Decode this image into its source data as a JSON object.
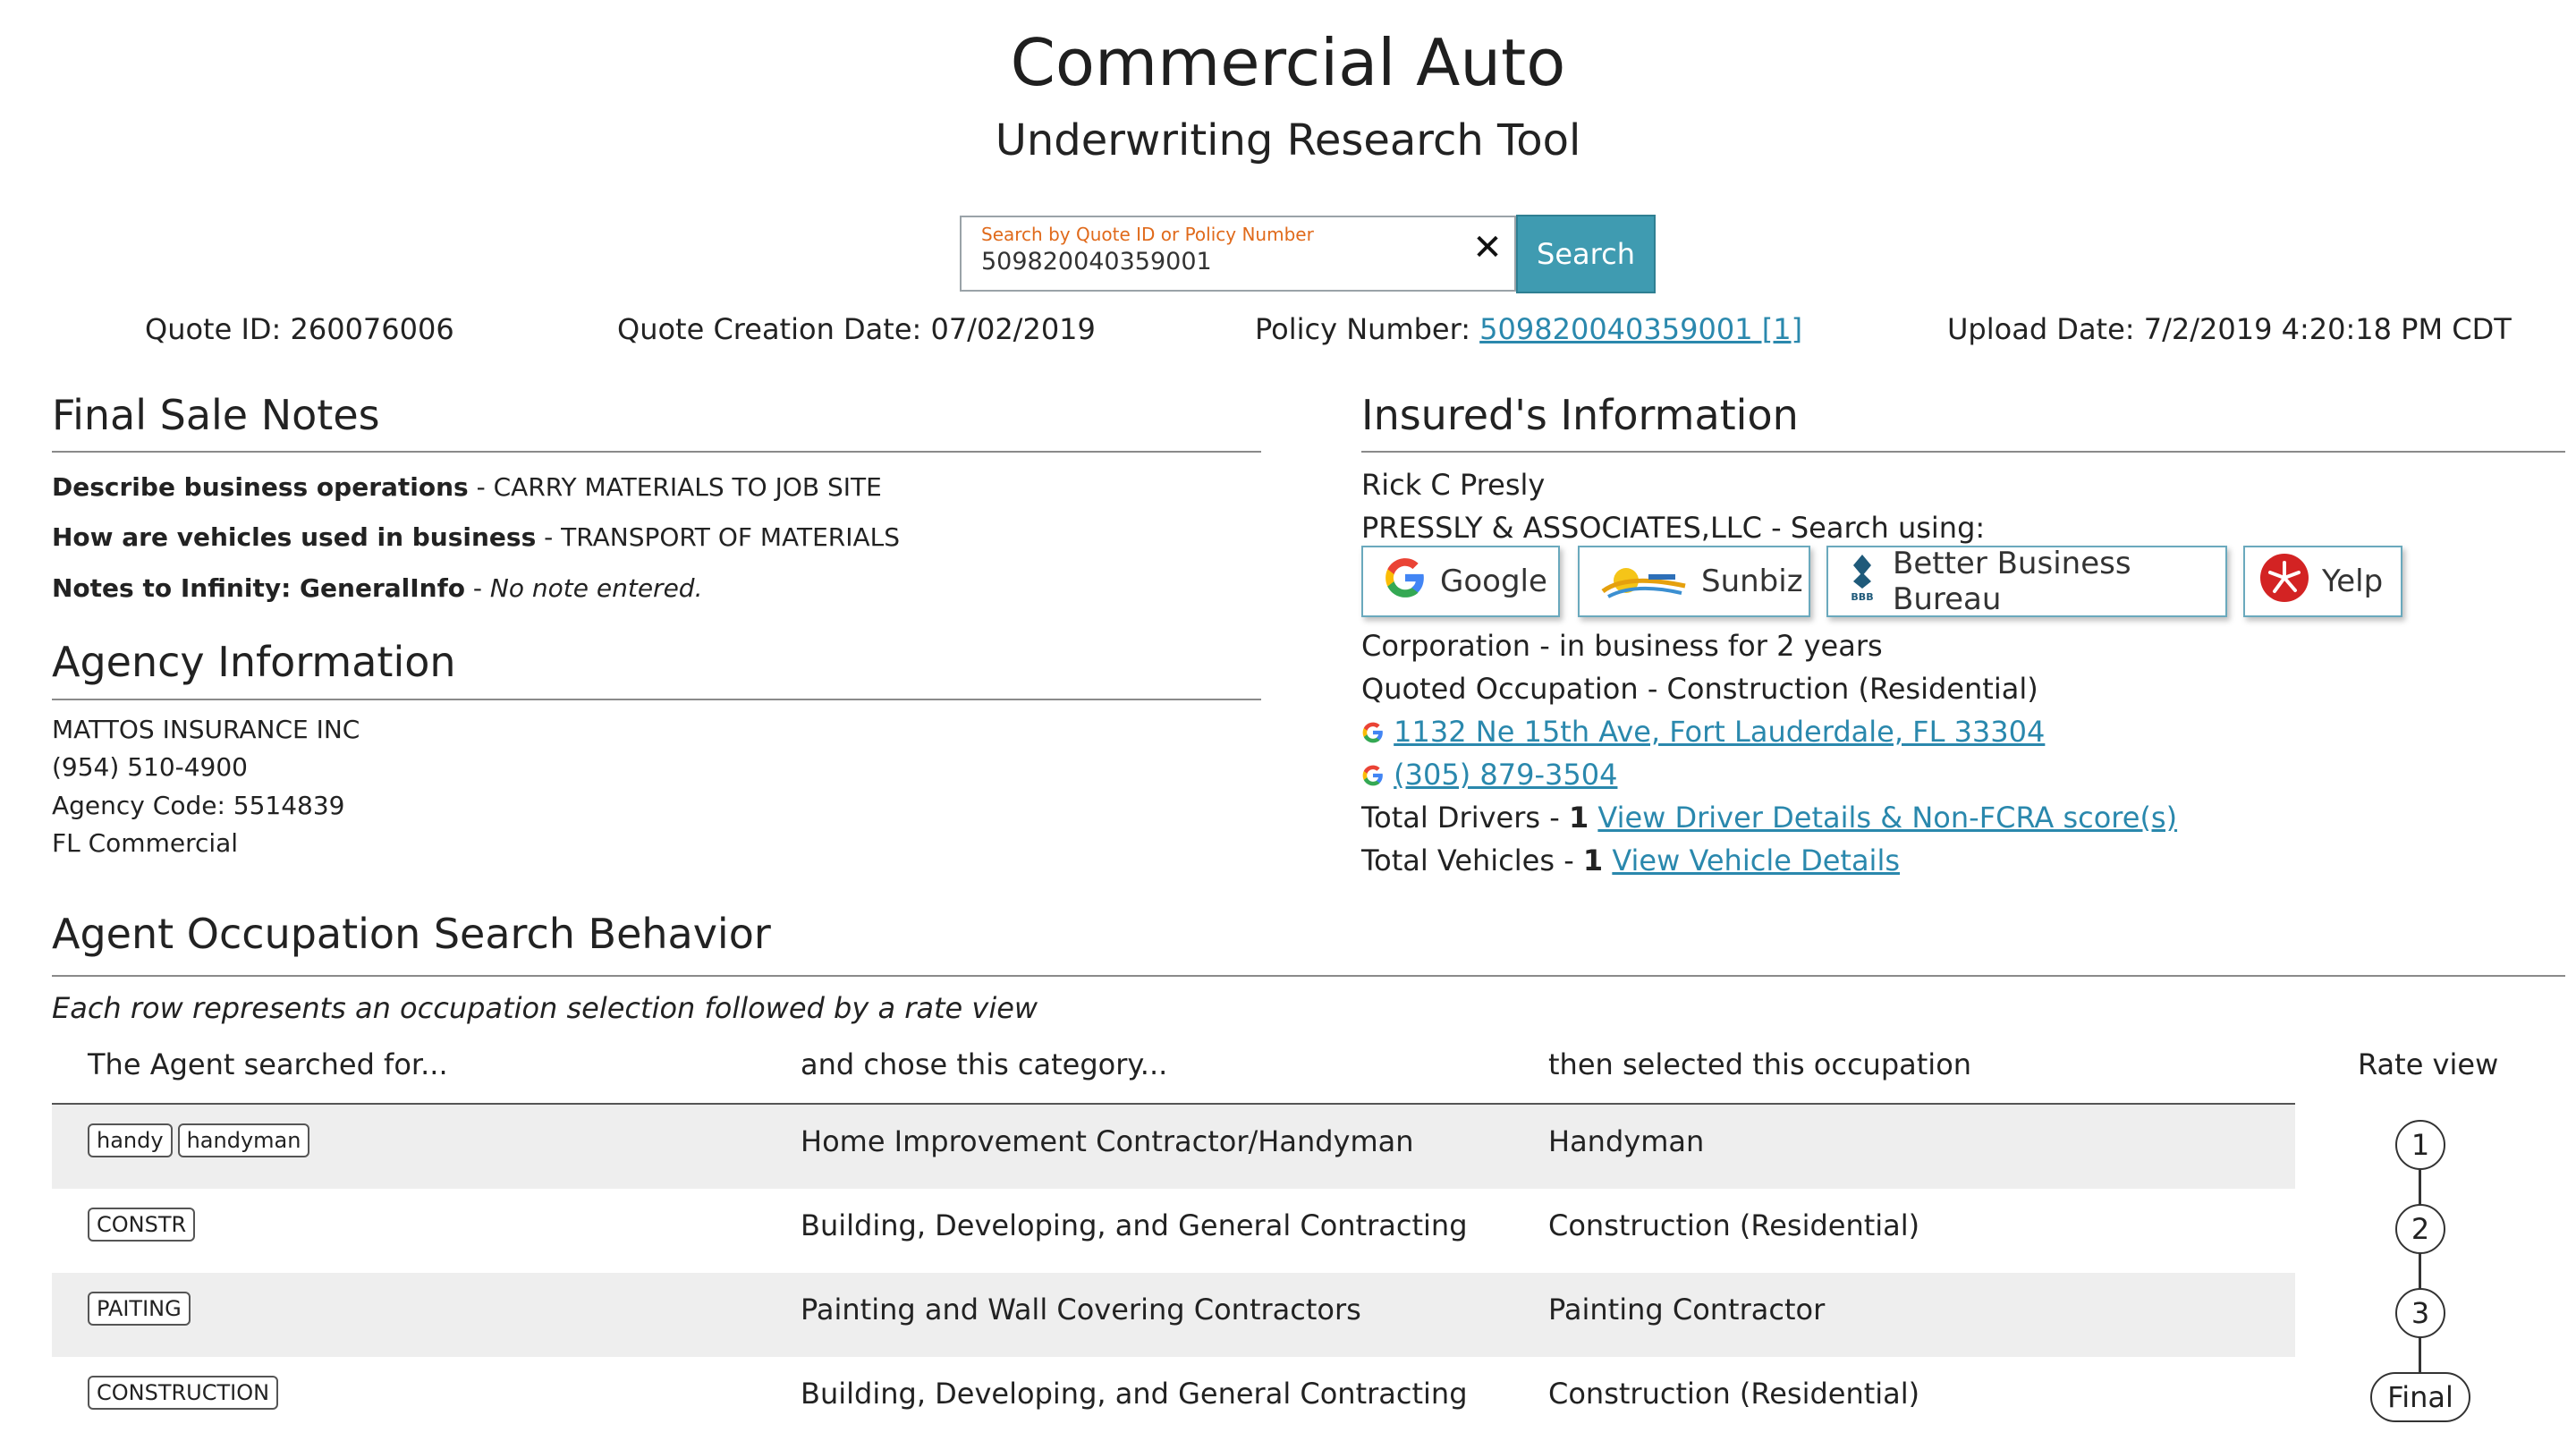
{
  "header": {
    "title": "Commercial Auto",
    "subtitle": "Underwriting Research Tool"
  },
  "search": {
    "label": "Search by Quote ID or Policy Number",
    "value": "509820040359001",
    "clear_icon": "close-x-icon",
    "button_label": "Search"
  },
  "meta": {
    "quote_id": "Quote ID: 260076006",
    "creation_date": "Quote Creation Date: 07/02/2019",
    "policy_label": "Policy Number:",
    "policy_link": "509820040359001 [1]",
    "upload_date": "Upload Date: 7/2/2019 4:20:18 PM CDT"
  },
  "final_sale_notes": {
    "heading": "Final Sale Notes",
    "items": [
      {
        "label": "Describe business operations",
        "sep": " - ",
        "value": "CARRY MATERIALS TO JOB SITE"
      },
      {
        "label": "How are vehicles used in business",
        "sep": " - ",
        "value": "TRANSPORT OF MATERIALS"
      },
      {
        "label": "Notes to Infinity: GeneralInfo",
        "sep": " - ",
        "value": "No note entered."
      }
    ]
  },
  "agency": {
    "heading": "Agency Information",
    "lines": [
      "MATTOS INSURANCE INC",
      "(954) 510-4900",
      "Agency Code: 5514839",
      "FL Commercial"
    ]
  },
  "insured": {
    "heading": "Insured's Information",
    "name": "Rick C Presly",
    "business_line": "PRESSLY & ASSOCIATES,LLC - Search using:",
    "buttons": [
      {
        "label": "Google",
        "icon": "google-icon"
      },
      {
        "label": "Sunbiz",
        "icon": "sunbiz-icon"
      },
      {
        "label": "Better Business Bureau",
        "icon": "bbb-icon"
      },
      {
        "label": "Yelp",
        "icon": "yelp-icon"
      }
    ],
    "business_type": "Corporation - in business for 2 years",
    "occupation": "Quoted Occupation - Construction (Residential)",
    "address": "1132 Ne 15th Ave, Fort Lauderdale, FL 33304",
    "phone": "(305) 879-3504",
    "drivers_label": "Total Drivers - ",
    "drivers_count": "1",
    "drivers_link": "View Driver Details & Non-FCRA score(s)",
    "vehicles_label": "Total Vehicles - ",
    "vehicles_count": "1",
    "vehicles_link": "View Vehicle Details"
  },
  "occupation_search": {
    "heading": "Agent Occupation Search Behavior",
    "note": "Each row represents an occupation selection followed by a rate view",
    "columns": [
      "The Agent searched for...",
      "and chose this category...",
      "then selected this occupation",
      "Rate view"
    ],
    "rows": [
      {
        "tags": [
          "handy",
          "handyman"
        ],
        "category": "Home Improvement Contractor/Handyman",
        "occupation": "Handyman"
      },
      {
        "tags": [
          "CONSTR"
        ],
        "category": "Building, Developing, and General Contracting",
        "occupation": "Construction (Residential)"
      },
      {
        "tags": [
          "PAITING"
        ],
        "category": "Painting and Wall Covering Contractors",
        "occupation": "Painting Contractor"
      },
      {
        "tags": [
          "CONSTRUCTION"
        ],
        "category": "Building, Developing, and General Contracting",
        "occupation": "Construction (Residential)"
      }
    ],
    "rate_views": [
      "1",
      "2",
      "3",
      "Final"
    ]
  },
  "colors": {
    "accent": "#3f9bb1",
    "link": "#2a88ad",
    "search_label": "#e06a1b",
    "row_shade": "#eeeeee"
  }
}
